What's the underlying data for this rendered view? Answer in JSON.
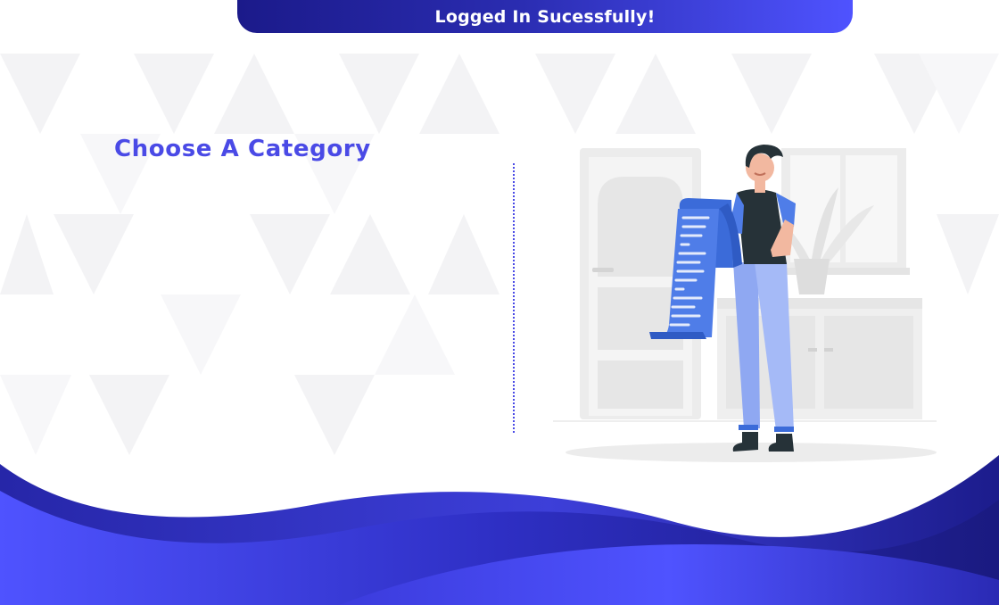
{
  "toast": {
    "message": "Logged In Sucessfully!",
    "colors": {
      "start": "#1b1a8a",
      "end": "#4f53ff"
    }
  },
  "main": {
    "title": "Choose A Category",
    "title_color": "#4a4ae6"
  },
  "illustration": {
    "icon": "person-reading-list-illustration"
  },
  "footer": {
    "colors": {
      "primary": "#3b3bdc",
      "dark": "#1a1a80",
      "accent": "#4f53ff"
    }
  }
}
